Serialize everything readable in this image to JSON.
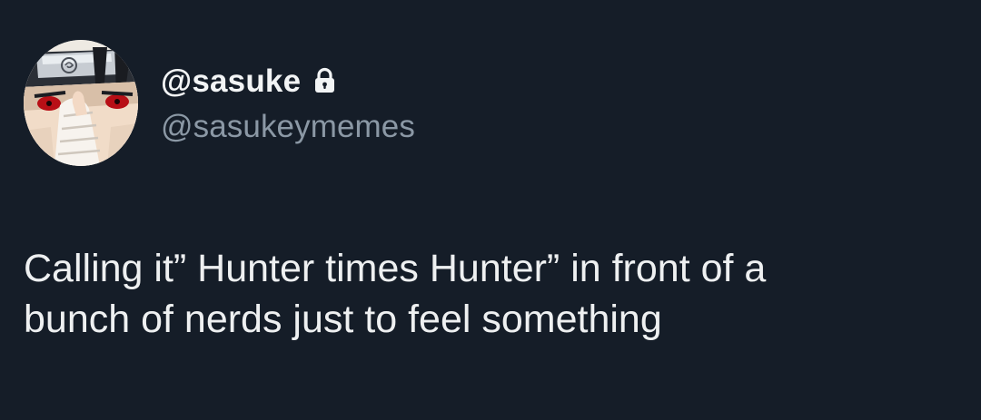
{
  "profile": {
    "display_name": "@sasuke",
    "handle": "@sasukeymemes",
    "lock_icon": "lock-icon",
    "avatar_icon": "anime-character-avatar"
  },
  "tweet": {
    "lines": [
      "Calling it” Hunter times Hunter” in front of a",
      "bunch of nerds just to feel something"
    ]
  },
  "colors": {
    "background": "#151d28",
    "primary_text": "#eef0f1",
    "secondary_text": "#8b98a5"
  }
}
